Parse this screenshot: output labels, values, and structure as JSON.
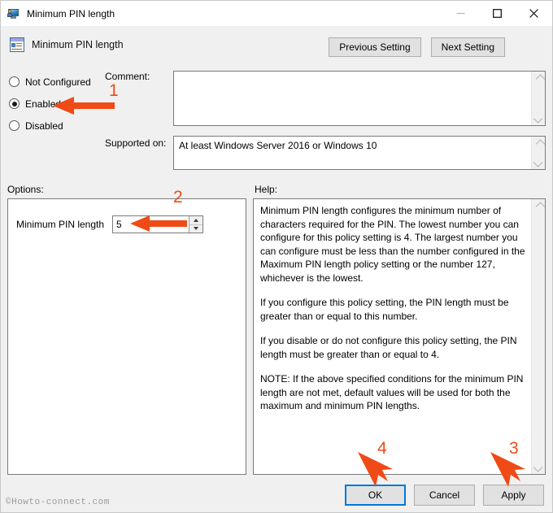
{
  "window": {
    "title": "Minimum PIN length",
    "title_icon": "policy-computer-icon",
    "minimize_label": "Minimize",
    "maximize_label": "Maximize",
    "close_label": "Close"
  },
  "header": {
    "icon": "group-policy-setting-icon",
    "title": "Minimum PIN length",
    "previous_button": "Previous Setting",
    "next_button": "Next Setting"
  },
  "state": {
    "options": [
      {
        "label": "Not Configured",
        "selected": false
      },
      {
        "label": "Enabled",
        "selected": true
      },
      {
        "label": "Disabled",
        "selected": false
      }
    ]
  },
  "comment": {
    "label": "Comment:",
    "value": "",
    "placeholder": ""
  },
  "supported_on": {
    "label": "Supported on:",
    "value": "At least Windows Server 2016 or Windows 10"
  },
  "options_panel": {
    "label": "Options:",
    "setting_label": "Minimum PIN length",
    "setting_value": "5"
  },
  "help_panel": {
    "label": "Help:",
    "paragraphs": [
      "Minimum PIN length configures the minimum number of characters required for the PIN.  The lowest number you can configure for this policy setting is 4.  The largest number you can configure must be less than the number configured in the Maximum PIN length policy setting or the number 127, whichever is the lowest.",
      "If you configure this policy setting, the PIN length must be greater than or equal to this number.",
      "If you disable or do not configure this policy setting, the PIN length must be greater than or equal to 4.",
      "NOTE: If the above specified conditions for the minimum PIN length are not met, default values will be used for both the maximum and minimum PIN lengths."
    ]
  },
  "dialog_buttons": {
    "ok": "OK",
    "cancel": "Cancel",
    "apply": "Apply"
  },
  "annotations": {
    "color": "#f04a16",
    "step1": "1",
    "step2": "2",
    "step3": "3",
    "step4": "4"
  },
  "watermark": "©Howto-connect.com"
}
